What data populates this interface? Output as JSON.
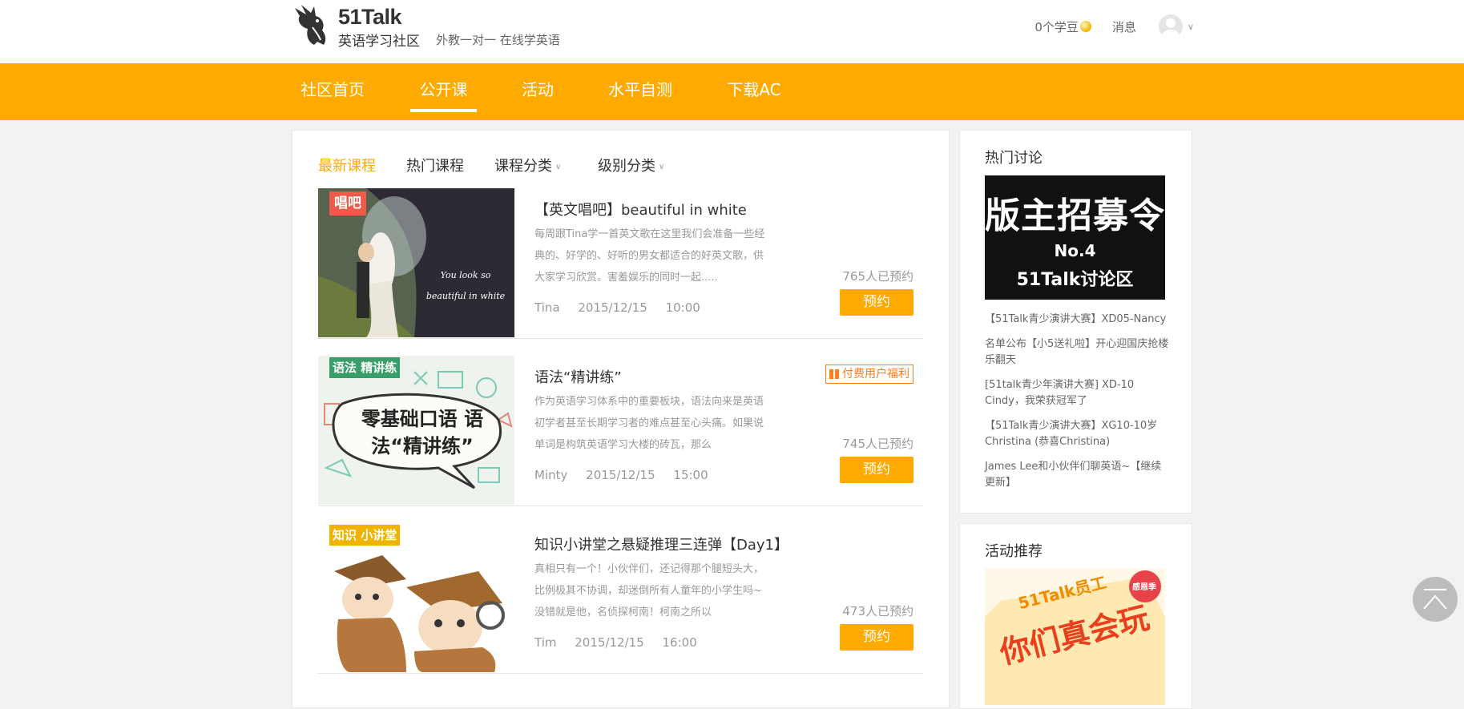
{
  "header": {
    "brand": "51Talk",
    "site_name": "英语学习社区",
    "slogan": "外教一对一  在线学英语",
    "beans": "0个学豆",
    "messages": "消息"
  },
  "nav": {
    "items": [
      {
        "label": "社区首页"
      },
      {
        "label": "公开课"
      },
      {
        "label": "活动"
      },
      {
        "label": "水平自测"
      },
      {
        "label": "下载AC"
      }
    ],
    "active_index": 1
  },
  "tabs": [
    {
      "label": "最新课程"
    },
    {
      "label": "热门课程"
    },
    {
      "label": "课程分类"
    },
    {
      "label": "级别分类"
    }
  ],
  "courses": [
    {
      "badge": "唱吧",
      "thumb_caption": "You look so beautiful in white",
      "title": "【英文唱吧】beautiful in white",
      "desc": "每周跟Tina学一首英文歌在这里我们会准备一些经典的、好学的、好听的男女都适合的好英文歌，供大家学习欣赏。害羞娱乐的同时一起.....",
      "teacher": "Tina",
      "date": "2015/12/15",
      "time": "10:00",
      "count": "765人已预约",
      "button": "预约"
    },
    {
      "badge": "语法 精讲练",
      "thumb_caption": "零基础口语 语法“精讲练”",
      "title": "语法“精讲练”",
      "perk": "付费用户福利",
      "desc": "作为英语学习体系中的重要板块，语法向来是英语初学者甚至长期学习者的难点甚至心头痛。如果说单词是构筑英语学习大楼的砖瓦，那么",
      "teacher": "Minty",
      "date": "2015/12/15",
      "time": "15:00",
      "count": "745人已预约",
      "button": "预约"
    },
    {
      "badge": "知识 小讲堂",
      "title": "知识小讲堂之悬疑推理三连弹【Day1】",
      "desc": "真相只有一个！小伙伴们，还记得那个腿短头大，比例极其不协调，却迷倒所有人童年的小学生吗~没错就是他，名侦探柯南！柯南之所以",
      "teacher": "Tim",
      "date": "2015/12/15",
      "time": "16:00",
      "count": "473人已预约",
      "button": "预约"
    }
  ],
  "sidebar": {
    "hot_title": "热门讨论",
    "banner_line1": "版主招募令",
    "banner_line2": "No.4",
    "banner_line3": "51Talk讨论区",
    "links": [
      "【51Talk青少演讲大赛】XD05-Nancy",
      "名单公布【小5送礼啦】开心迎国庆抢楼乐翻天",
      "[51talk青少年演讲大赛] XD-10 Cindy，我荣获冠军了",
      "【51Talk青少演讲大赛】XG10-10岁Christina (恭喜Christina)",
      "James Lee和小伙伴们聊英语~【继续更新】"
    ],
    "activity_title": "活动推荐",
    "activity_banner_line1": "51Talk员工",
    "activity_banner_line2": "你们真会玩",
    "activity_sticker": "感恩季"
  },
  "colors": {
    "accent": "#ffaa00",
    "perk": "#ff7e1a"
  }
}
